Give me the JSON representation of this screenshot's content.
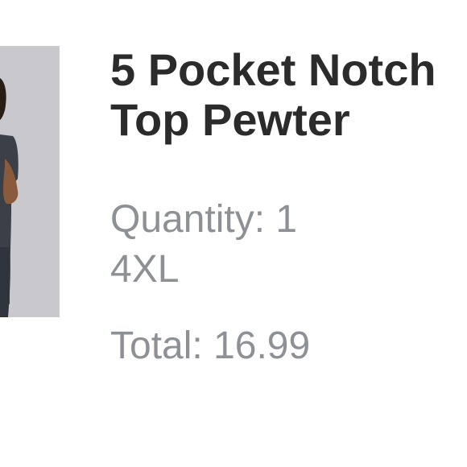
{
  "product": {
    "title_line1": "5 Pocket Notch",
    "title_line2": "Top Pewter",
    "image_alt": "product-photo",
    "quantity_text": "Quantity: 1",
    "size_text": "4XL",
    "total_text": "Total: 16.99",
    "quantity": 1,
    "size": "4XL",
    "total": 16.99
  },
  "colors": {
    "title": "#2b2b2b",
    "meta": "#8d9095",
    "photo_bg": "#c9c8cd",
    "garment": "#3a3f48",
    "skin": "#8a5a3c"
  }
}
